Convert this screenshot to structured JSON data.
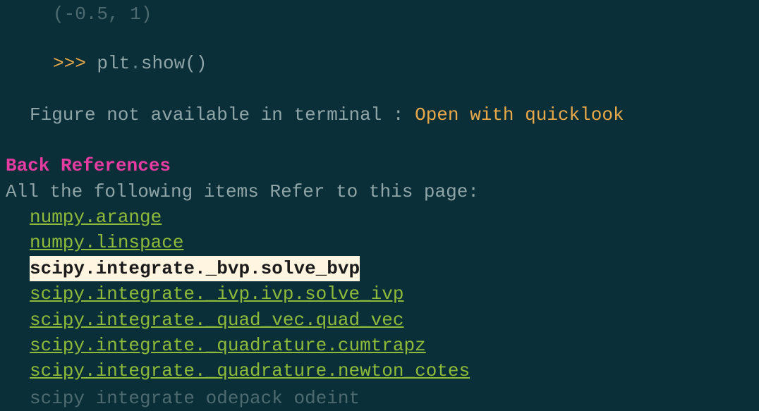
{
  "code": {
    "truncated_top": "(-0.5, 1)",
    "prompt": ">>> ",
    "module": "plt",
    "dot": ".",
    "method": "show",
    "parens": "()"
  },
  "figure": {
    "text": "Figure not available in terminal : ",
    "link": "Open with quicklook"
  },
  "backref": {
    "header": "Back References",
    "desc": "All the following items Refer to this page:"
  },
  "refs": {
    "r0": "numpy.arange",
    "r1": "numpy.linspace",
    "r2": "scipy.integrate._bvp.solve_bvp",
    "r3": "scipy.integrate._ivp.ivp.solve_ivp",
    "r4": "scipy.integrate._quad_vec.quad_vec",
    "r5": "scipy.integrate._quadrature.cumtrapz",
    "r6": "scipy.integrate._quadrature.newton_cotes",
    "r7": "scipy integrate odepack odeint"
  }
}
